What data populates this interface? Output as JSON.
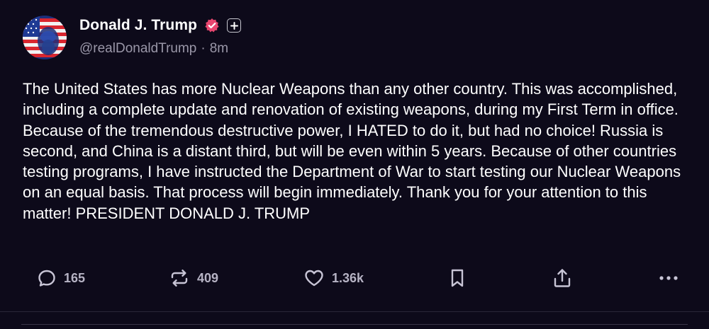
{
  "post": {
    "author": {
      "display_name": "Donald J. Trump",
      "handle": "@realDonaldTrump",
      "separator": "·",
      "time_ago": "8m",
      "verified_icon": "verified-check-icon",
      "badge_icon": "plus-badge-icon"
    },
    "body": "The United States has more Nuclear Weapons than any other country. This was accomplished, including a complete update and renovation of existing weapons, during my First Term in office. Because of the tremendous destructive power, I HATED to do it, but had no choice! Russia is second, and China is a distant third, but will be even within 5 years. Because of other countries testing programs, I have instructed the Department of War to start testing our Nuclear Weapons on an equal basis. That process will begin immediately. Thank you for your attention to this matter! PRESIDENT DONALD J. TRUMP",
    "actions": {
      "replies": {
        "icon": "reply-icon",
        "count": "165"
      },
      "retruths": {
        "icon": "retruth-icon",
        "count": "409"
      },
      "likes": {
        "icon": "heart-icon",
        "count": "1.36k"
      },
      "bookmark": {
        "icon": "bookmark-icon"
      },
      "share": {
        "icon": "share-icon"
      },
      "more": {
        "icon": "more-icon"
      }
    }
  },
  "colors": {
    "background": "#0d0a1a",
    "text": "#ffffff",
    "muted": "#9a97a8",
    "verified": "#e8466f"
  }
}
